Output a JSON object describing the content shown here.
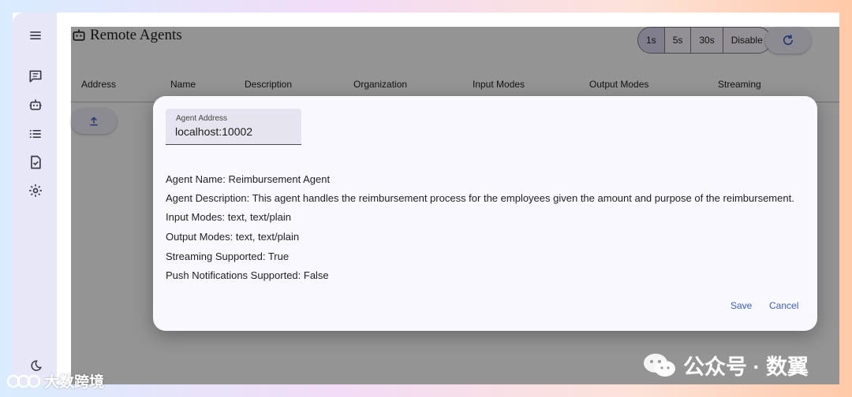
{
  "app": {
    "title": "Remote Agents"
  },
  "sidebar": {
    "items": [
      {
        "icon": "menu-icon"
      },
      {
        "icon": "chat-icon"
      },
      {
        "icon": "robot-icon"
      },
      {
        "icon": "list-icon"
      },
      {
        "icon": "task-icon"
      },
      {
        "icon": "gear-icon"
      }
    ],
    "bottom_icon": "moon-icon"
  },
  "toolbar": {
    "refresh_options": [
      "1s",
      "5s",
      "30s",
      "Disable"
    ],
    "selected": "1s",
    "refresh_icon": "refresh-icon"
  },
  "table": {
    "columns": [
      "Address",
      "Name",
      "Description",
      "Organization",
      "Input Modes",
      "Output Modes",
      "Streaming"
    ]
  },
  "upload": {
    "icon": "upload-icon"
  },
  "dialog": {
    "field_label": "Agent Address",
    "field_value": "localhost:10002",
    "lines": [
      "Agent Name: Reimbursement Agent",
      "Agent Description: This agent handles the reimbursement process for the employees given the amount and purpose of the reimbursement.",
      "Input Modes: text, text/plain",
      "Output Modes: text, text/plain",
      "Streaming Supported: True",
      "Push Notifications Supported: False"
    ],
    "save_label": "Save",
    "cancel_label": "Cancel"
  },
  "watermarks": {
    "left": "大数跨境",
    "right": "公众号 · 数翼"
  },
  "colors": {
    "accent": "#3a60c8",
    "sidebar_bg": "#e8e7f8",
    "dialog_bg": "#f9f8ff"
  }
}
